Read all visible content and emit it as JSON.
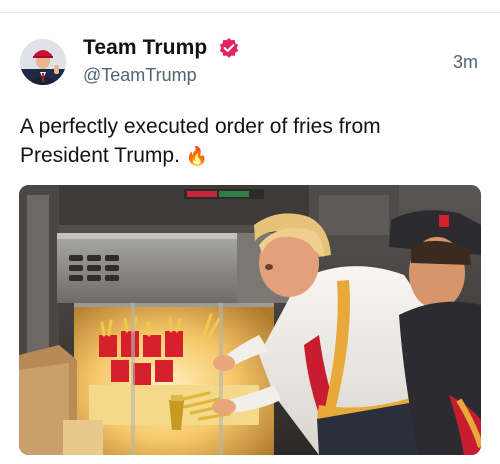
{
  "post": {
    "author_name": "Team Trump",
    "handle": "@TeamTrump",
    "timestamp": "3m",
    "text_line1": "A perfectly executed order of fries from",
    "text_line2": "President Trump.",
    "emoji": "🔥",
    "verified_icon": "verified-badge-icon",
    "accent_color": "#e0245e"
  },
  "media": {
    "type": "photo",
    "caption_visible": false
  }
}
